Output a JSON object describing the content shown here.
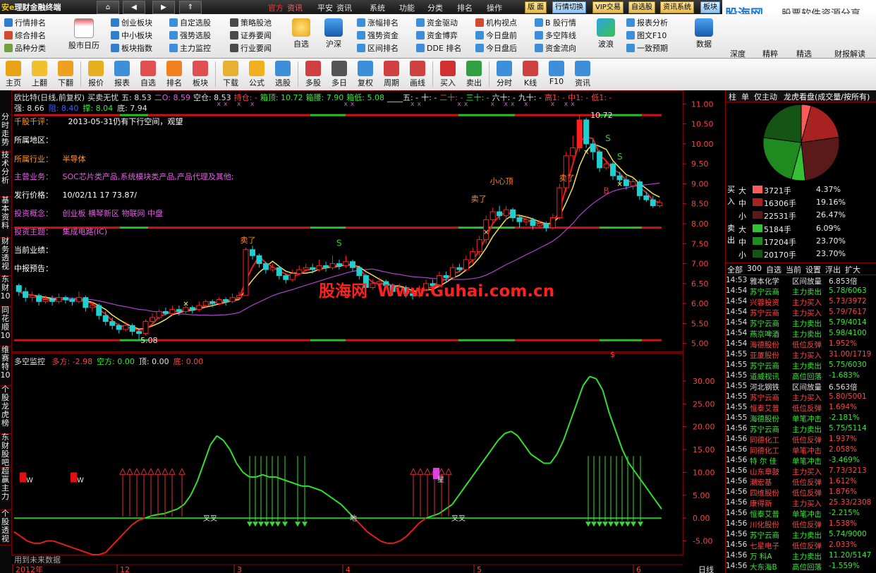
{
  "menubar": {
    "logo_prefix": "安e",
    "logo_main": "理财金融终端",
    "nav_home": "⌂",
    "nav_back": "◀",
    "nav_fwd": "▶",
    "nav_up": "⇑",
    "items": [
      "官方",
      "资讯",
      "平安",
      "资讯",
      "系统",
      "功能",
      "分类",
      "排名",
      "操作"
    ],
    "buttons": [
      "版 面",
      "行情切换",
      "VIP交易",
      "自选股",
      "资讯系统",
      "板块"
    ]
  },
  "brand": {
    "name": "股海网",
    "slogan": "股票软件资源分享",
    "url": "Www.Guhai.com.cn"
  },
  "toolbar1": {
    "col1": [
      "行情排名",
      "综合排名",
      "品种分类"
    ],
    "calendar": "股市日历",
    "col2": [
      "创业板块",
      "中小板块",
      "板块指数"
    ],
    "col3": [
      "自定选股",
      "强势选股",
      "主力监控"
    ],
    "col4": [
      "策略股池",
      "证券要闻",
      "行业要闻"
    ],
    "zixuan": "自选",
    "hushen": "沪深",
    "col5": [
      "涨幅排名",
      "强势资金",
      "区间排名"
    ],
    "col6": [
      "资金驱动",
      "资金博弈",
      "DDE 排名"
    ],
    "col7": [
      "机构视点",
      "今日盘前",
      "今日盘后"
    ],
    "col8": [
      "B 股行情",
      "多空阵线",
      "资金流向"
    ],
    "bolang": "波浪",
    "col9": [
      "报表分析",
      "图文F10",
      "一致预期"
    ],
    "big_right": [
      "数据",
      "深度",
      "精粹",
      "精选",
      "财报解读"
    ]
  },
  "toolbar2": [
    "主页",
    "上翻",
    "下翻",
    "报价",
    "报表",
    "自选",
    "排名",
    "板块",
    "下载",
    "公式",
    "选股",
    "多股",
    "多日",
    "复权",
    "周期",
    "画线",
    "买入",
    "卖出",
    "分时",
    "K线",
    "F10",
    "资讯"
  ],
  "left_tabs": [
    "分时走势",
    "技术分析",
    "基本资料",
    "财务透视",
    "东财10",
    "同花顺10",
    "维赛特10",
    "个股龙虎榜",
    "东财股吧",
    "超赢主力",
    "个股透视"
  ],
  "kline": {
    "header1": [
      {
        "t": "欧比特(日线,前复权)",
        "c": "#e0e0e0"
      },
      {
        "t": "买卖无忧",
        "c": "#e0e0e0"
      },
      {
        "t": "五: 8.53",
        "c": "#e0e0e0"
      },
      {
        "t": "二O: 8.59",
        "c": "#e45ee4"
      },
      {
        "t": "空仓: 8.53",
        "c": "#e0e0e0"
      },
      {
        "t": "持仓: -",
        "c": "#ff4444"
      },
      {
        "t": "箱顶: 10.72",
        "c": "#35ea35"
      },
      {
        "t": "箱腰: 7.90",
        "c": "#35ea35"
      },
      {
        "t": "箱低: 5.08",
        "c": "#35ea35"
      },
      {
        "t": "____五: -",
        "c": "#e0e0e0"
      },
      {
        "t": "十: -",
        "c": "#e0e0e0"
      },
      {
        "t": "二十: -",
        "c": "#ff4444"
      },
      {
        "t": "三十: -",
        "c": "#35ea35"
      },
      {
        "t": "六十: -",
        "c": "#e0e0e0"
      },
      {
        "t": "九十: -",
        "c": "#e0e0e0"
      },
      {
        "t": "高1: -",
        "c": "#ff4444"
      },
      {
        "t": "中1: -",
        "c": "#ff4444"
      },
      {
        "t": "低1: -",
        "c": "#ff4444"
      }
    ],
    "header2": [
      {
        "t": "强: 8.66",
        "c": "#e0e0e0"
      },
      {
        "t": "阻: 8.40",
        "c": "#4060ff"
      },
      {
        "t": "撑: 8.04",
        "c": "#35ea35"
      },
      {
        "t": "底: 7.94",
        "c": "#e0e0e0"
      }
    ],
    "info": {
      "commentary_label": "千股千评：",
      "commentary_value": "2013-05-31仍有下行空间，观望",
      "region_label": "所属地区：",
      "region_value": "",
      "industry_label": "所属行业：",
      "industry_value": "半导体",
      "business_label": "主营业务：",
      "business_value": "SOC芯片类产品,系统模块类产品,产品代理及其他;",
      "ipo_label": "发行价格：",
      "ipo_value": "10/02/11 17 73.87/",
      "concept_label": "投资概念：",
      "concept_value": "创业板 横琴新区 物联网 中盘",
      "theme_label": "投资主题：",
      "theme_value": "集成电路(IC)",
      "perf_label": "当前业绩：",
      "forecast_label": "中报预告："
    },
    "price_axis": [
      "11.00",
      "10.50",
      "10.00",
      "9.50",
      "9.00",
      "8.50",
      "8.00",
      "7.50",
      "7.00",
      "6.50",
      "6.00",
      "5.50",
      "5.00"
    ],
    "annotations": {
      "high": "10.72",
      "low": "5.08",
      "sell": "卖了",
      "caution": "小心顶",
      "s": "S",
      "b": "B",
      "dollar": "$"
    }
  },
  "indicator": {
    "title": "多空监控",
    "header": [
      {
        "t": "多方: -2.98",
        "c": "#ff4444"
      },
      {
        "t": "空方: 0.00",
        "c": "#35ea35"
      },
      {
        "t": "顶: 0.00",
        "c": "#e0e0e0"
      },
      {
        "t": "底: 0.00",
        "c": "#ff4444"
      }
    ],
    "axis": [
      "30.00",
      "25.00",
      "20.00",
      "15.00",
      "10.00",
      "5.00",
      "0.00",
      "-5.00"
    ],
    "marks": {
      "w": "W",
      "cross": "叉叉",
      "di": "地",
      "star": "星"
    },
    "footnote": "用到未来数据"
  },
  "xaxis": {
    "labels": [
      "2012年",
      "12",
      "3",
      "4",
      "5",
      "6"
    ],
    "period": "日线"
  },
  "rightpanel": {
    "tabs": [
      "柱",
      "单",
      "仅主动",
      "龙虎看盘(成交量/按所有)"
    ],
    "pie": {
      "buy_pct": [
        4.37,
        19.16,
        26.47
      ],
      "sell_pct": [
        6.09,
        23.7,
        23.7
      ]
    },
    "buy_label": "买入",
    "sell_label": "卖出",
    "buy_rows": [
      {
        "size": "大",
        "vol": "3721手",
        "pct": "4.37%"
      },
      {
        "size": "中",
        "vol": "16306手",
        "pct": "19.16%"
      },
      {
        "size": "小",
        "vol": "22531手",
        "pct": "26.47%"
      }
    ],
    "sell_rows": [
      {
        "size": "大",
        "vol": "5184手",
        "pct": "6.09%"
      },
      {
        "size": "中",
        "vol": "17204手",
        "pct": "23.70%"
      },
      {
        "size": "小",
        "vol": "20170手",
        "pct": "23.70%"
      }
    ],
    "menu": [
      "全部",
      "300",
      "自选",
      "当前",
      "设置",
      "浮出",
      "扩大"
    ],
    "ticks": [
      {
        "time": "14:53",
        "name": "雅本化学",
        "event": "区间放量",
        "val": "6.853倍",
        "c": "#e0e0e0"
      },
      {
        "time": "14:54",
        "name": "苏宁云商",
        "event": "主力卖出",
        "val": "5.78/6063",
        "c": "#35ea35"
      },
      {
        "time": "14:54",
        "name": "兴蓉投资",
        "event": "主力买入",
        "val": "5.73/3972",
        "c": "#ff4444"
      },
      {
        "time": "14:54",
        "name": "苏宁云商",
        "event": "主力买入",
        "val": "5.79/7617",
        "c": "#ff4444"
      },
      {
        "time": "14:54",
        "name": "苏宁云商",
        "event": "主力卖出",
        "val": "5.79/4014",
        "c": "#35ea35"
      },
      {
        "time": "14:54",
        "name": "燕京啤酒",
        "event": "主力卖出",
        "val": "5.98/4100",
        "c": "#35ea35"
      },
      {
        "time": "14:54",
        "name": "海德股份",
        "event": "低位反弹",
        "val": "1.952%",
        "c": "#ff4444"
      },
      {
        "time": "14:55",
        "name": "亚厦股份",
        "event": "主力买入",
        "val": "31.00/1719",
        "c": "#ff4444"
      },
      {
        "time": "14:55",
        "name": "苏宁云商",
        "event": "主力卖出",
        "val": "5.75/6030",
        "c": "#35ea35"
      },
      {
        "time": "14:55",
        "name": "道威视讯",
        "event": "高位回落",
        "val": "-1.683%",
        "c": "#35ea35"
      },
      {
        "time": "14:55",
        "name": "河北钢铁",
        "event": "区间放量",
        "val": "6.563倍",
        "c": "#e0e0e0"
      },
      {
        "time": "14:55",
        "name": "苏宁云商",
        "event": "主力买入",
        "val": "5.80/5001",
        "c": "#ff4444"
      },
      {
        "time": "14:55",
        "name": "恒泰艾普",
        "event": "低位反弹",
        "val": "1.694%",
        "c": "#ff4444"
      },
      {
        "time": "14:55",
        "name": "海德股份",
        "event": "单笔冲击",
        "val": "-2.181%",
        "c": "#35ea35"
      },
      {
        "time": "14:56",
        "name": "苏宁云商",
        "event": "主力卖出",
        "val": "5.75/5114",
        "c": "#35ea35"
      },
      {
        "time": "14:56",
        "name": "同德化工",
        "event": "低位反弹",
        "val": "1.937%",
        "c": "#ff4444"
      },
      {
        "time": "14:56",
        "name": "同德化工",
        "event": "单笔冲击",
        "val": "2.058%",
        "c": "#ff4444"
      },
      {
        "time": "14:56",
        "name": "特 尔 佳",
        "event": "单笔冲击",
        "val": "-3.469%",
        "c": "#35ea35"
      },
      {
        "time": "14:56",
        "name": "山东章鼓",
        "event": "主力买入",
        "val": "7.73/3213",
        "c": "#ff4444"
      },
      {
        "time": "14:56",
        "name": "潮宏基",
        "event": "低位反弹",
        "val": "1.612%",
        "c": "#ff4444"
      },
      {
        "time": "14:56",
        "name": "四维股份",
        "event": "低位反弹",
        "val": "1.876%",
        "c": "#ff4444"
      },
      {
        "time": "14:56",
        "name": "康得新",
        "event": "主力买入",
        "val": "25.33/2308",
        "c": "#ff4444"
      },
      {
        "time": "14:56",
        "name": "恒泰艾普",
        "event": "单笔冲击",
        "val": "-2.215%",
        "c": "#35ea35"
      },
      {
        "time": "14:56",
        "name": "川化股份",
        "event": "低位反弹",
        "val": "1.538%",
        "c": "#ff4444"
      },
      {
        "time": "14:56",
        "name": "苏宁云商",
        "event": "主力卖出",
        "val": "5.74/9000",
        "c": "#35ea35"
      },
      {
        "time": "14:56",
        "name": "七星电子",
        "event": "低位反弹",
        "val": "2.033%",
        "c": "#ff4444"
      },
      {
        "time": "14:56",
        "name": "万 科A",
        "event": "主力卖出",
        "val": "11.20/5147",
        "c": "#35ea35"
      },
      {
        "time": "14:56",
        "name": "大东海B",
        "event": "高位回落",
        "val": "-1.559%",
        "c": "#35ea35"
      }
    ]
  },
  "chart_data": {
    "type": "candlestick",
    "title": "欧比特(日线,前复权)",
    "ylim": [
      4.8,
      11.2
    ],
    "candles": [
      [
        6.45,
        6.3,
        6.5,
        6.2
      ],
      [
        6.3,
        6.15,
        6.4,
        6.05
      ],
      [
        6.15,
        6.2,
        6.3,
        6.05
      ],
      [
        6.2,
        6.05,
        6.25,
        5.95
      ],
      [
        6.05,
        6.1,
        6.2,
        6.0
      ],
      [
        6.1,
        6.05,
        6.2,
        5.95
      ],
      [
        6.05,
        6.15,
        6.25,
        6.0
      ],
      [
        6.15,
        6.1,
        6.2,
        6.0
      ],
      [
        6.1,
        6.05,
        6.15,
        5.95
      ],
      [
        6.05,
        6.15,
        6.3,
        6.0
      ],
      [
        6.15,
        5.9,
        6.2,
        5.8
      ],
      [
        5.9,
        5.95,
        6.05,
        5.8
      ],
      [
        5.95,
        5.7,
        6.0,
        5.6
      ],
      [
        5.7,
        5.55,
        5.8,
        5.45
      ],
      [
        5.55,
        5.45,
        5.65,
        5.35
      ],
      [
        5.45,
        5.35,
        5.5,
        5.25
      ],
      [
        5.35,
        5.45,
        5.55,
        5.3
      ],
      [
        5.45,
        5.3,
        5.5,
        5.2
      ],
      [
        5.3,
        5.25,
        5.35,
        5.08
      ],
      [
        5.25,
        5.55,
        5.6,
        5.2
      ],
      [
        5.55,
        5.65,
        5.75,
        5.5
      ],
      [
        5.65,
        5.8,
        5.85,
        5.6
      ],
      [
        5.8,
        5.75,
        5.9,
        5.7
      ],
      [
        5.75,
        5.85,
        5.95,
        5.7
      ],
      [
        5.85,
        5.8,
        5.95,
        5.7
      ],
      [
        5.8,
        5.9,
        6.0,
        5.75
      ],
      [
        5.9,
        5.85,
        5.95,
        5.75
      ],
      [
        5.85,
        5.95,
        6.05,
        5.8
      ],
      [
        5.95,
        6.05,
        6.1,
        5.9
      ],
      [
        6.05,
        6.0,
        6.1,
        5.9
      ],
      [
        6.0,
        6.1,
        6.15,
        5.95
      ],
      [
        6.1,
        6.05,
        6.15,
        5.95
      ],
      [
        6.05,
        6.15,
        6.25,
        6.0
      ],
      [
        6.15,
        6.2,
        6.3,
        6.1
      ],
      [
        6.2,
        7.35,
        7.4,
        6.2
      ],
      [
        7.35,
        7.2,
        7.45,
        7.1
      ],
      [
        7.2,
        7.0,
        7.25,
        6.9
      ],
      [
        7.0,
        6.85,
        7.05,
        6.75
      ],
      [
        6.85,
        6.9,
        7.0,
        6.8
      ],
      [
        6.9,
        6.7,
        6.95,
        6.6
      ],
      [
        6.7,
        6.6,
        6.75,
        6.5
      ],
      [
        6.6,
        6.75,
        6.85,
        6.55
      ],
      [
        6.75,
        6.85,
        6.95,
        6.7
      ],
      [
        6.85,
        6.9,
        7.0,
        6.8
      ],
      [
        6.9,
        6.85,
        7.0,
        6.75
      ],
      [
        6.85,
        6.95,
        7.1,
        6.8
      ],
      [
        6.95,
        6.9,
        7.05,
        6.8
      ],
      [
        6.9,
        7.0,
        7.2,
        6.85
      ],
      [
        7.0,
        6.95,
        7.1,
        6.85
      ],
      [
        6.95,
        7.05,
        7.2,
        6.9
      ],
      [
        7.05,
        6.9,
        7.1,
        6.8
      ],
      [
        6.9,
        6.7,
        6.95,
        6.6
      ],
      [
        6.7,
        6.4,
        6.75,
        6.3
      ],
      [
        6.4,
        6.5,
        6.6,
        6.35
      ],
      [
        6.5,
        6.55,
        6.65,
        6.45
      ],
      [
        6.55,
        6.45,
        6.6,
        6.4
      ],
      [
        6.45,
        6.3,
        6.5,
        6.2
      ],
      [
        6.3,
        6.4,
        6.5,
        6.25
      ],
      [
        6.4,
        6.25,
        6.45,
        6.15
      ],
      [
        6.25,
        6.2,
        6.3,
        6.1
      ],
      [
        6.2,
        6.35,
        6.45,
        6.15
      ],
      [
        6.35,
        6.5,
        6.6,
        6.3
      ],
      [
        6.5,
        6.45,
        6.6,
        6.4
      ],
      [
        6.45,
        6.7,
        6.8,
        6.4
      ],
      [
        6.7,
        6.65,
        6.8,
        6.55
      ],
      [
        6.65,
        6.9,
        7.0,
        6.6
      ],
      [
        6.9,
        6.85,
        7.0,
        6.8
      ],
      [
        6.85,
        7.1,
        7.2,
        6.8
      ],
      [
        7.1,
        7.3,
        7.4,
        7.0
      ],
      [
        7.3,
        7.6,
        7.7,
        7.2
      ],
      [
        7.6,
        8.1,
        8.2,
        7.5
      ],
      [
        8.1,
        8.3,
        8.4,
        8.0
      ],
      [
        8.3,
        8.2,
        8.45,
        8.1
      ],
      [
        8.2,
        8.35,
        8.45,
        8.1
      ],
      [
        8.35,
        8.15,
        8.4,
        8.05
      ],
      [
        8.15,
        8.05,
        8.2,
        7.9
      ],
      [
        8.05,
        8.1,
        8.2,
        7.95
      ],
      [
        8.1,
        7.95,
        8.15,
        7.85
      ],
      [
        7.95,
        8.0,
        8.1,
        7.9
      ],
      [
        8.0,
        7.9,
        8.05,
        7.8
      ],
      [
        7.9,
        8.15,
        8.25,
        7.85
      ],
      [
        8.15,
        8.9,
        9.0,
        8.1
      ],
      [
        8.9,
        9.7,
        9.8,
        8.8
      ],
      [
        9.7,
        9.9,
        10.2,
        9.6
      ],
      [
        9.9,
        10.6,
        10.72,
        9.8
      ],
      [
        10.6,
        10.0,
        10.65,
        9.9
      ],
      [
        10.0,
        9.8,
        10.1,
        9.6
      ],
      [
        9.8,
        9.4,
        9.85,
        9.3
      ],
      [
        9.4,
        9.5,
        9.6,
        9.35
      ],
      [
        9.5,
        9.2,
        9.55,
        9.1
      ],
      [
        9.2,
        9.1,
        9.3,
        9.0
      ],
      [
        9.1,
        8.95,
        9.2,
        8.85
      ],
      [
        8.95,
        9.05,
        9.15,
        8.85
      ],
      [
        9.05,
        8.7,
        9.1,
        8.6
      ],
      [
        8.7,
        8.6,
        8.8,
        8.55
      ],
      [
        8.6,
        8.45,
        8.7,
        8.4
      ],
      [
        8.45,
        8.53,
        8.6,
        8.4
      ]
    ],
    "indicator_series": {
      "name": "多空监控",
      "ylim": [
        -8,
        34
      ],
      "values": [
        -3,
        -4,
        -5,
        -5.5,
        -5.5,
        -5,
        -5,
        -5.5,
        -6,
        -6.5,
        -7,
        -7.5,
        -8,
        -8,
        -7.5,
        -6,
        -4.5,
        -3,
        -1.5,
        -0.5,
        0,
        0.5,
        0.8,
        1,
        1.5,
        2,
        3,
        5,
        8,
        12,
        16,
        18,
        17,
        15,
        12,
        10,
        9,
        9,
        9.5,
        9,
        9,
        8.5,
        8,
        7.5,
        7,
        7,
        6.5,
        6,
        5,
        4,
        3,
        1.5,
        0,
        -1.5,
        -3,
        -4,
        -5,
        -5.5,
        -5.5,
        -5,
        -4,
        -2.5,
        -1,
        0,
        0.5,
        1,
        2,
        3,
        5,
        7,
        9,
        11,
        13,
        15,
        17,
        18.5,
        19,
        18,
        16,
        14,
        13,
        12,
        12,
        14,
        17,
        21,
        25,
        29,
        31,
        30.5,
        28,
        23,
        19,
        15,
        12,
        10,
        8,
        6,
        4,
        2
      ]
    }
  }
}
